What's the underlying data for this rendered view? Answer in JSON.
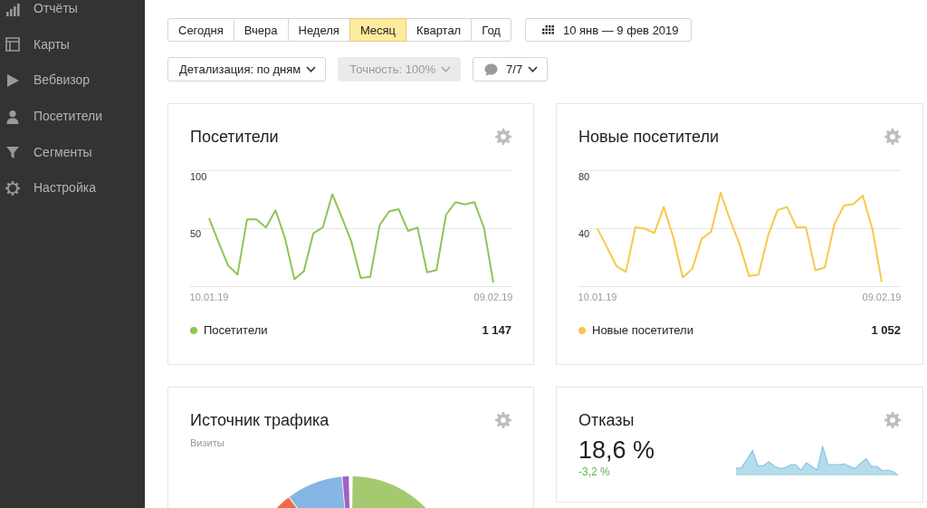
{
  "sidebar": {
    "items": [
      {
        "label": "Отчёты"
      },
      {
        "label": "Карты"
      },
      {
        "label": "Вебвизор"
      },
      {
        "label": "Посетители"
      },
      {
        "label": "Сегменты"
      },
      {
        "label": "Настройка"
      }
    ]
  },
  "period_tabs": [
    {
      "label": "Сегодня",
      "selected": false
    },
    {
      "label": "Вчера",
      "selected": false
    },
    {
      "label": "Неделя",
      "selected": false
    },
    {
      "label": "Месяц",
      "selected": true
    },
    {
      "label": "Квартал",
      "selected": false
    },
    {
      "label": "Год",
      "selected": false
    }
  ],
  "date_range": {
    "label": "10 янв — 9 фев 2019"
  },
  "filters": [
    {
      "kind": "dropdown",
      "label": "Детализация: по дням",
      "disabled": false
    },
    {
      "kind": "dropdown",
      "label": "Точность: 100%",
      "disabled": true
    },
    {
      "kind": "comments",
      "label": "7/7",
      "disabled": false
    }
  ],
  "widgets": [
    {
      "kind": "line_chart",
      "title": "Посетители",
      "total": "1 147",
      "chart_data": {
        "type": "line",
        "categories": [
          "10.01.19",
          null,
          null,
          null,
          null,
          null,
          null,
          null,
          null,
          null,
          null,
          null,
          null,
          null,
          null,
          null,
          null,
          null,
          null,
          null,
          null,
          null,
          null,
          null,
          null,
          null,
          null,
          null,
          null,
          null,
          "09.02.19"
        ],
        "ylim": [
          0,
          100
        ],
        "yticks": [
          50,
          100
        ],
        "series": [
          {
            "name": "Посетители",
            "color": "#8cc657",
            "values": [
              59,
              38,
              18,
              10,
              58,
              58,
              51,
              66,
              42,
              6,
              13,
              46,
              51,
              80,
              60,
              39,
              7,
              8,
              53,
              65,
              67,
              48,
              51,
              12,
              14,
              62,
              73,
              71,
              73,
              51,
              3
            ]
          }
        ]
      }
    },
    {
      "kind": "line_chart",
      "title": "Новые посетители",
      "total": "1 052",
      "chart_data": {
        "type": "line",
        "categories": [
          "10.01.19",
          null,
          null,
          null,
          null,
          null,
          null,
          null,
          null,
          null,
          null,
          null,
          null,
          null,
          null,
          null,
          null,
          null,
          null,
          null,
          null,
          null,
          null,
          null,
          null,
          null,
          null,
          null,
          null,
          null,
          "09.02.19"
        ],
        "ylim": [
          0,
          80
        ],
        "yticks": [
          40,
          80
        ],
        "series": [
          {
            "name": "Новые посетители",
            "color": "#f8c84a",
            "values": [
              40,
              27,
              14,
              10,
              41,
              40,
              37,
              55,
              34,
              6,
              12,
              33,
              38,
              65,
              46,
              29,
              7,
              8,
              35,
              53,
              55,
              41,
              41,
              11,
              13,
              43,
              56,
              57,
              63,
              40,
              3
            ]
          }
        ]
      }
    },
    {
      "kind": "pie",
      "title": "Источник трафика",
      "subtitle": "Визиты"
    },
    {
      "kind": "metric",
      "title": "Отказы",
      "value": "18,6 %",
      "change": "-3,2 %",
      "change_good": true
    }
  ]
}
